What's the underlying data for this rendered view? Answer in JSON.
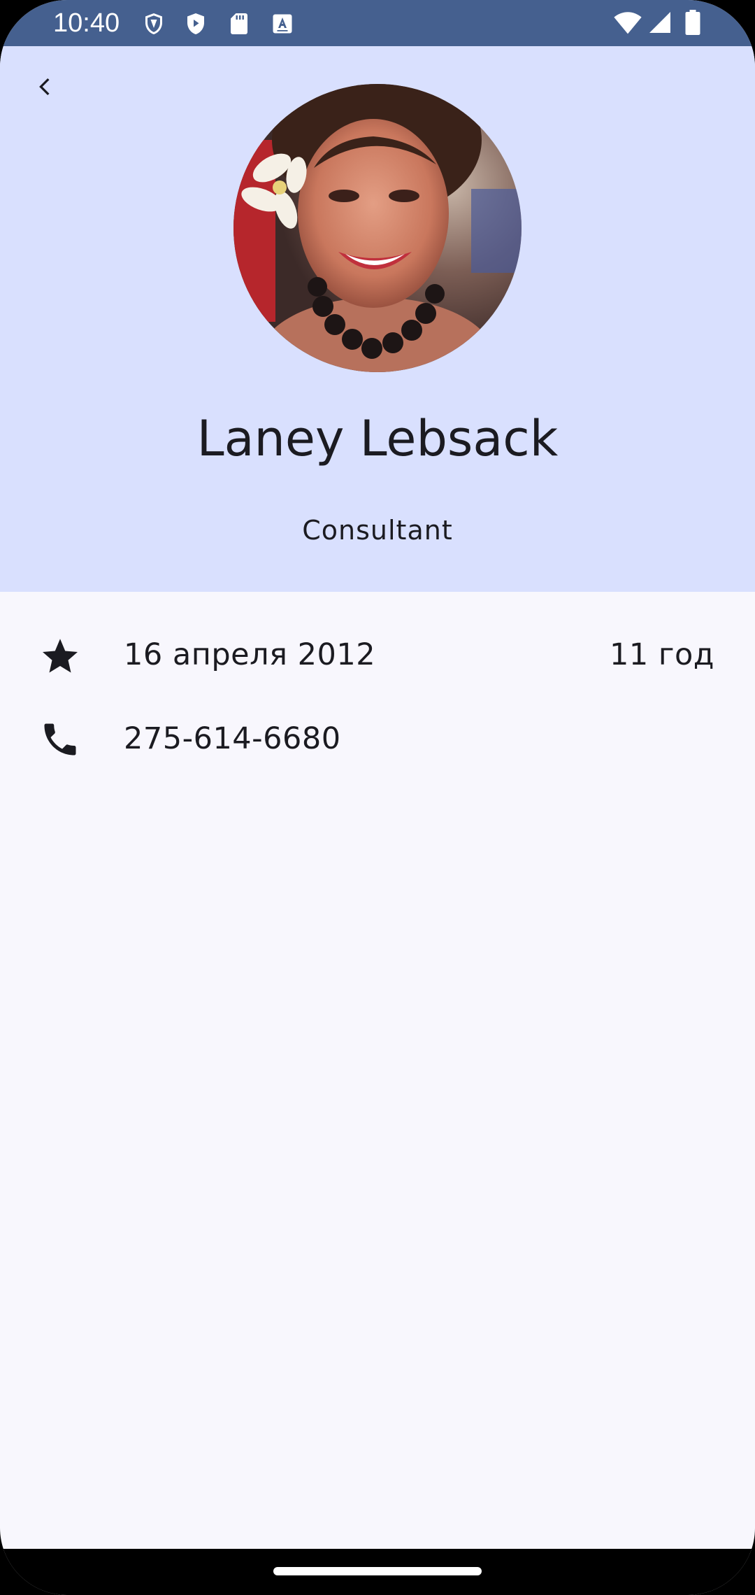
{
  "status_bar": {
    "time": "10:40",
    "left_icons": [
      "shield-outline-icon",
      "play-shield-icon",
      "sd-card-icon",
      "keyboard-a-icon"
    ],
    "right_icons": [
      "wifi-icon",
      "signal-icon",
      "battery-icon"
    ]
  },
  "header": {
    "back_icon": "chevron-left-icon",
    "name": "Laney Lebsack",
    "position": "Consultant"
  },
  "details": {
    "hire_date": "16 апреля 2012",
    "tenure": "11 год",
    "phone": "275-614-6680"
  },
  "colors": {
    "status_bar": "#45608f",
    "header_bg": "#d9e0fe",
    "page_bg": "#f8f7fd",
    "text": "#1b1b21"
  }
}
